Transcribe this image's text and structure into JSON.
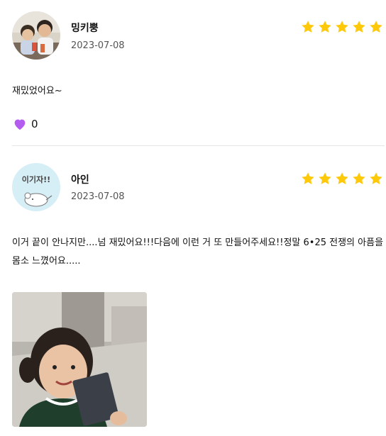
{
  "reviews": [
    {
      "username": "밍키뿡",
      "date": "2023-07-08",
      "rating": 5,
      "text": "재밌었어요~",
      "like_count": "0",
      "avatar": "children-photo"
    },
    {
      "username": "아인",
      "date": "2023-07-08",
      "rating": 5,
      "text": "이거 끝이 안나지만....넘 재밌어요!!!다음에 이런 거 또 만들어주세요!!정말 6•25 전쟁의 아픔을 몸소 느꼈어요.....",
      "avatar": "cartoon-avatar",
      "avatar_text": "이기자!!",
      "photo": "child-holding-booklet-photo"
    }
  ],
  "colors": {
    "star": "#FFC90B",
    "heart": "#B45CF0",
    "divider": "#E6E6E6",
    "date": "#555555",
    "avatar_bg": "#D6EEF6"
  },
  "icons": {
    "star": "star-icon",
    "like": "heart-icon"
  }
}
